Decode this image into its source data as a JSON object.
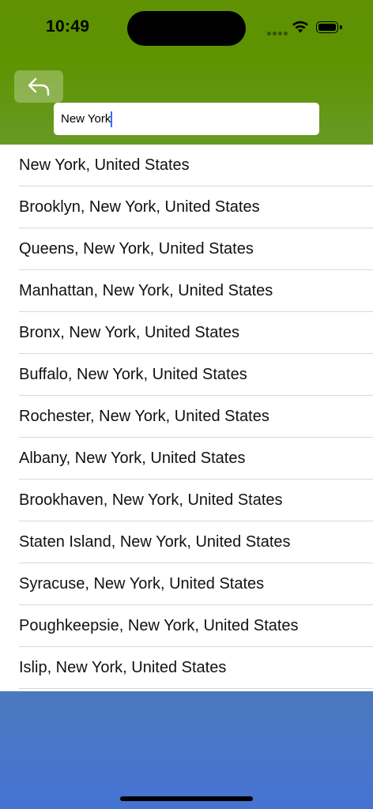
{
  "status_bar": {
    "time": "10:49"
  },
  "header": {
    "back_button_icon": "reply-arrow-icon",
    "search": {
      "value": "New York",
      "placeholder": ""
    }
  },
  "results": [
    "New York, United States",
    "Brooklyn, New York, United States",
    "Queens, New York, United States",
    "Manhattan, New York, United States",
    "Bronx, New York, United States",
    "Buffalo, New York, United States",
    "Rochester, New York, United States",
    "Albany, New York, United States",
    "Brookhaven, New York, United States",
    "Staten Island, New York, United States",
    "Syracuse, New York, United States",
    "Poughkeepsie, New York, United States",
    "Islip, New York, United States"
  ],
  "colors": {
    "header_green": "#5f9103",
    "footer_blue": "#4673d3",
    "caret_blue": "#2f6ff0"
  }
}
